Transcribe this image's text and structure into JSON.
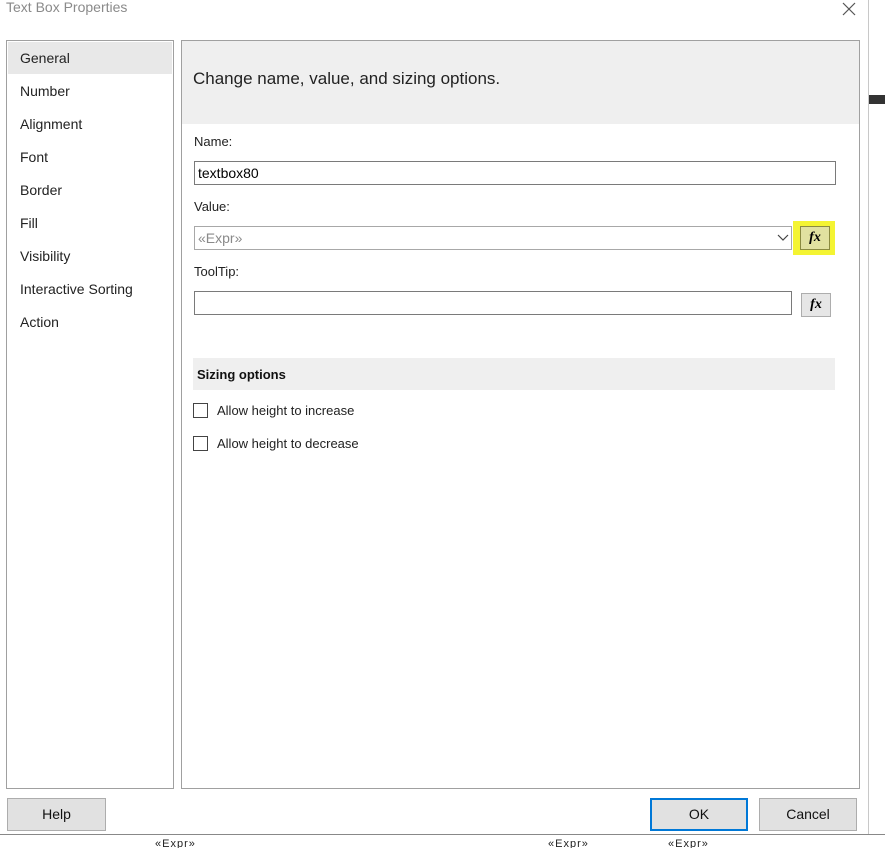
{
  "window": {
    "title": "Text Box Properties"
  },
  "sidebar": {
    "items": [
      {
        "label": "General",
        "selected": true
      },
      {
        "label": "Number"
      },
      {
        "label": "Alignment"
      },
      {
        "label": "Font"
      },
      {
        "label": "Border"
      },
      {
        "label": "Fill"
      },
      {
        "label": "Visibility"
      },
      {
        "label": "Interactive Sorting"
      },
      {
        "label": "Action"
      }
    ]
  },
  "main": {
    "header": "Change name, value, and sizing options.",
    "name_label": "Name:",
    "name_value": "textbox80",
    "value_label": "Value:",
    "value_value": "«Expr»",
    "tooltip_label": "ToolTip:",
    "tooltip_value": "",
    "fx_label": "fx",
    "fx_highlight_color": "#f4f432",
    "sizing_header": "Sizing options",
    "checkboxes": [
      {
        "label": "Allow height to increase",
        "checked": false
      },
      {
        "label": "Allow height to decrease",
        "checked": false
      }
    ]
  },
  "footer": {
    "help_label": "Help",
    "ok_label": "OK",
    "cancel_label": "Cancel"
  },
  "background": {
    "expr_fragments": [
      "«Expr»",
      "«Expr»",
      "«Expr»"
    ]
  },
  "colors": {
    "accent": "#0078d7",
    "highlight": "#f4f432"
  }
}
